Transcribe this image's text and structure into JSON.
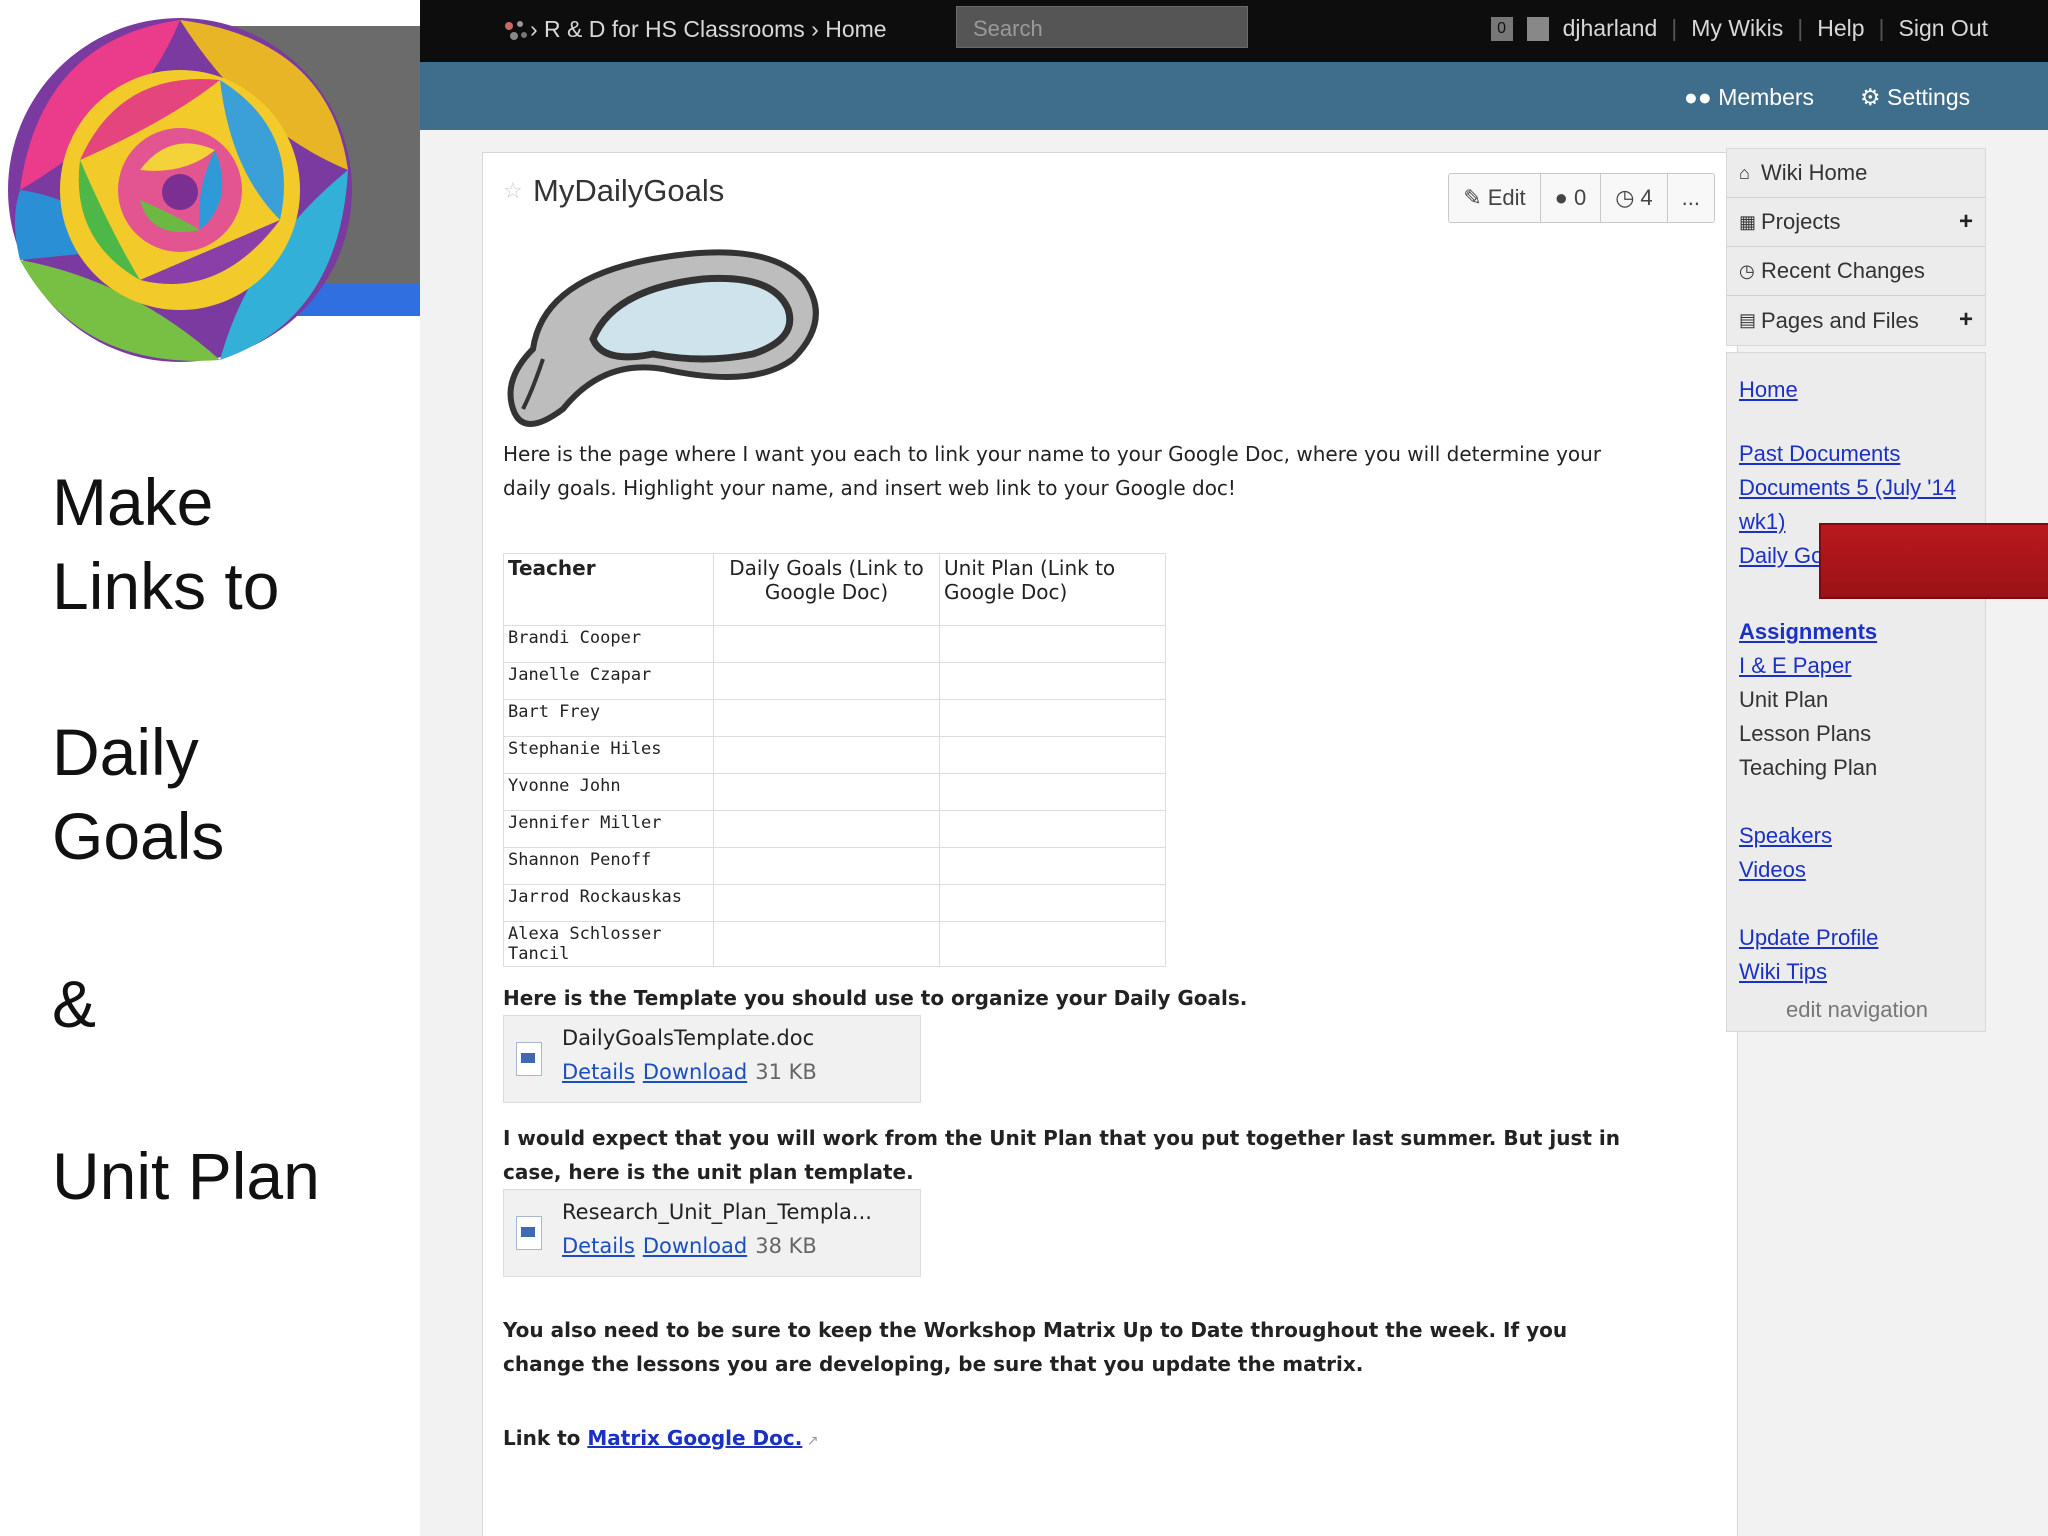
{
  "slide": {
    "text_lines": [
      "Make",
      "Links to",
      "Daily",
      "Goals",
      "&",
      "Unit Plan"
    ]
  },
  "topbar": {
    "breadcrumb": "› R & D for HS Classrooms › Home",
    "search_placeholder": "Search",
    "badge_count": "0",
    "username": "djharland",
    "my_wikis": "My Wikis",
    "help": "Help",
    "sign_out": "Sign Out"
  },
  "subbar": {
    "members": "Members",
    "settings": "Settings"
  },
  "page": {
    "title": "MyDailyGoals",
    "edit_label": "Edit",
    "comments_count": "0",
    "history_count": "4",
    "more_label": "...",
    "intro": "Here is the page where I want you each to link your name to your Google Doc, where you will determine your daily goals. Highlight your name, and insert web link to your Google doc!",
    "table": {
      "headers": [
        "Teacher",
        "Daily Goals (Link to Google Doc)",
        "Unit Plan (Link to Google Doc)"
      ],
      "rows": [
        "Brandi Cooper",
        "Janelle Czapar",
        "Bart Frey",
        "Stephanie Hiles",
        "Yvonne John",
        "Jennifer Miller",
        "Shannon Penoff",
        "Jarrod Rockauskas",
        "Alexa Schlosser Tancil"
      ]
    },
    "template_text": "Here is the Template you should use to organize your Daily Goals.",
    "file1": {
      "name": "DailyGoalsTemplate.doc",
      "details": "Details",
      "download": "Download",
      "size": "31 KB"
    },
    "unit_plan_text": "I would expect that you will work from the Unit Plan that you put together last summer. But just in case, here is the unit plan template.",
    "file2": {
      "name": "Research_Unit_Plan_Templa...",
      "details": "Details",
      "download": "Download",
      "size": "38 KB"
    },
    "matrix_text": "You also need to be sure to keep the Workshop Matrix Up to Date throughout the week. If you change the lessons you are developing, be sure that you update the matrix.",
    "link_prefix": "Link to ",
    "matrix_link": "Matrix Google Doc."
  },
  "nav": {
    "top_items": [
      {
        "label": "Wiki Home",
        "icon": "home-icon"
      },
      {
        "label": "Projects",
        "icon": "sitemap-icon",
        "plus": "+"
      },
      {
        "label": "Recent Changes",
        "icon": "clock-icon"
      },
      {
        "label": "Pages and Files",
        "icon": "file-icon",
        "plus": "+"
      }
    ],
    "links": {
      "home": "Home",
      "past_documents": "Past Documents",
      "documents_5": "Documents 5 (July '14",
      "wk1": "wk1)",
      "daily_goals": "Daily Goals",
      "assignments": "Assignments",
      "ie_paper": "I & E Paper",
      "unit_plan": "Unit Plan",
      "lesson_plans": "Lesson Plans",
      "teaching_plan": "Teaching Plan",
      "speakers": "Speakers",
      "videos": "Videos",
      "update_profile": "Update Profile",
      "wiki_tips": "Wiki Tips",
      "edit_navigation": "edit navigation"
    }
  },
  "colors": {
    "topbar": "#0d0d0d",
    "subbar": "#3f6d8c",
    "link": "#1b31c4",
    "arrow": "#b0161a"
  }
}
